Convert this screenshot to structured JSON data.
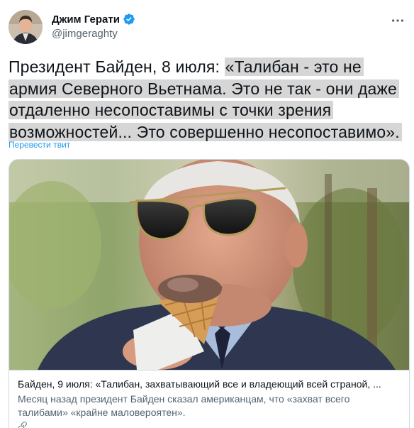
{
  "author": {
    "display_name": "Джим Герати",
    "handle": "@jimgeraghty",
    "verified": true
  },
  "tweet": {
    "lead_text": "Президент Байден, 8 июля: ",
    "highlighted_text": "«Талибан - это не армия Северного Вьетнама. Это не так - они даже отдаленно несопоставимы с точки зрения возможностей... Это совершенно несопоставимо».",
    "translate_label": "Перевести твит"
  },
  "card": {
    "title": "Байден, 9 июля: «Талибан, захватывающий все и владеющий всей страной, ...",
    "description": "Месяц назад президент Байден сказал американцам, что «захват всего талибами» «крайне маловероятен».",
    "domain": "",
    "image_subject": "photo"
  },
  "icons": {
    "verified": "verified-badge-icon",
    "more": "more-options-icon",
    "link": "link-icon"
  },
  "colors": {
    "accent": "#1d9bf0",
    "text_primary": "#0f1419",
    "text_secondary": "#536471",
    "highlight": "#d6d6d6",
    "border": "#cfd9de"
  }
}
